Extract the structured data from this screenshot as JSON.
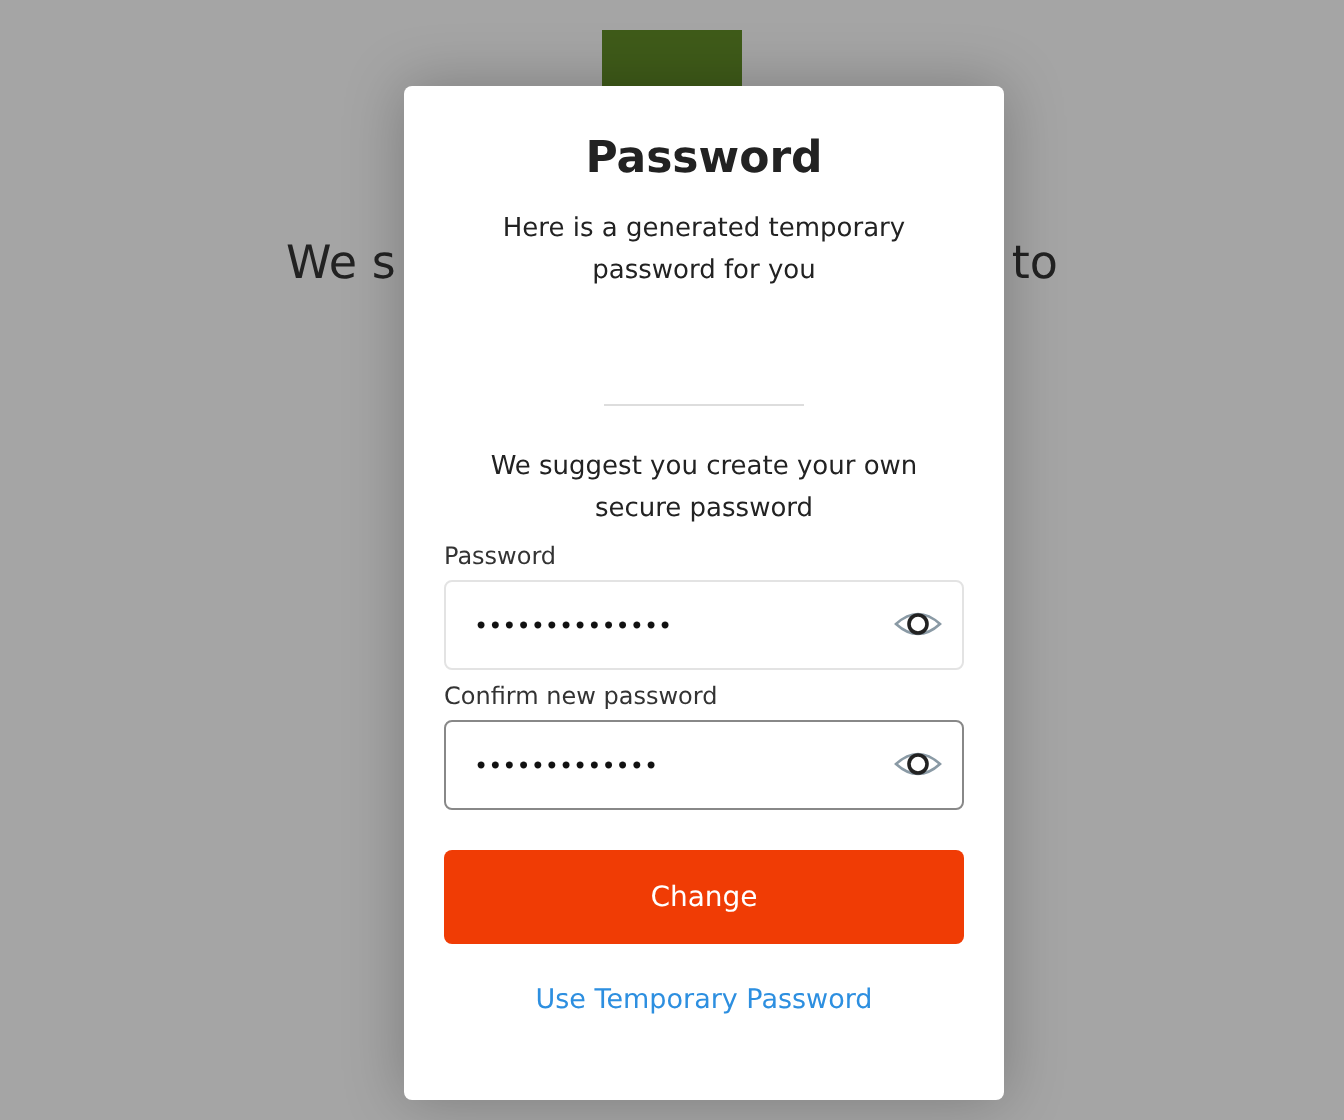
{
  "background": {
    "heading_left": "We s",
    "heading_right": "to"
  },
  "dialog": {
    "title": "Password",
    "intro": "Here is a generated temporary password for you",
    "suggestion": "We suggest you create your own secure password",
    "fields": [
      {
        "label": "Password",
        "value": "••••••••••••••",
        "focused": false
      },
      {
        "label": "Confirm new password",
        "value": "•••••••••••••",
        "focused": true
      }
    ],
    "primary_button": "Change",
    "link": "Use Temporary Password"
  }
}
